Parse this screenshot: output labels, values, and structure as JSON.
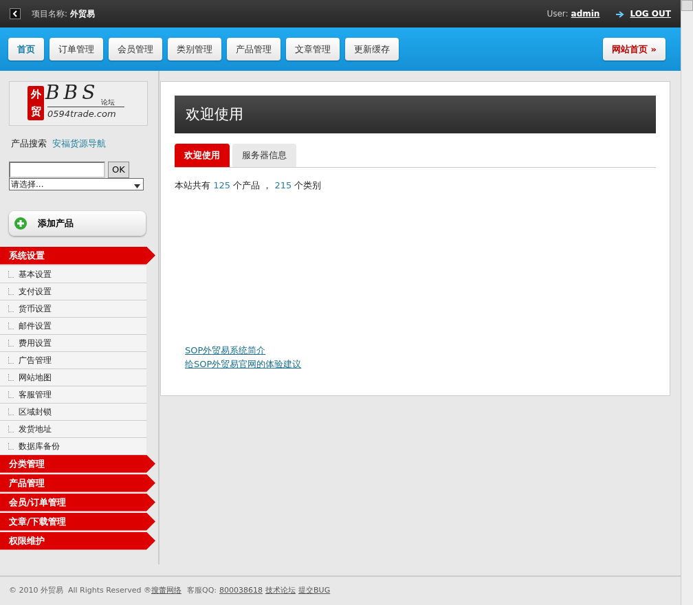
{
  "topbar": {
    "project_label": "项目名称:",
    "project_name": "外贸易",
    "user_label": "User:",
    "user_name": "admin",
    "logout": "LOG OUT"
  },
  "nav": {
    "tabs": [
      {
        "label": "首页",
        "selected": true
      },
      {
        "label": "订单管理",
        "selected": false
      },
      {
        "label": "会员管理",
        "selected": false
      },
      {
        "label": "类别管理",
        "selected": false
      },
      {
        "label": "产品管理",
        "selected": false
      },
      {
        "label": "文章管理",
        "selected": false
      },
      {
        "label": "更新缓存",
        "selected": false
      }
    ],
    "site_button": "网站首页 »"
  },
  "sidebar": {
    "logo": {
      "seal_top": "外",
      "seal_bottom": "贸",
      "title": "BBS",
      "tag": "论坛",
      "domain": "0594trade.com"
    },
    "search_label": "产品搜索",
    "search_link": "安福货源导航",
    "ok": "OK",
    "select": "请选择...",
    "add_button": "添加产品",
    "sections": [
      {
        "label": "系统设置",
        "children": [
          "基本设置",
          "支付设置",
          "货币设置",
          "邮件设置",
          "费用设置",
          "广告管理",
          "网站地图",
          "客服管理",
          "区域封锁",
          "发货地址",
          "数据库备份"
        ]
      },
      {
        "label": "分类管理"
      },
      {
        "label": "产品管理"
      },
      {
        "label": "会员/订单管理"
      },
      {
        "label": "文章/下载管理"
      },
      {
        "label": "权限维护"
      }
    ]
  },
  "main": {
    "title": "欢迎使用",
    "tabs": [
      {
        "label": "欢迎使用",
        "selected": true
      },
      {
        "label": "服务器信息",
        "selected": false
      }
    ],
    "stats": {
      "prefix": "本站共有",
      "products": "125",
      "mid": "个产品 ，",
      "categories": "215",
      "suffix": "个类别"
    },
    "links": [
      "SOP外贸易系统简介",
      "给SOP外贸易官网的体验建议"
    ]
  },
  "footer": {
    "copyright": "© 2010 外贸易  All Rights Reserved ®",
    "company": "搜蕾网络",
    "qq_label": "客服QQ:",
    "qq": "800038618",
    "forum": "技术论坛",
    "bug": "提交BUG"
  }
}
